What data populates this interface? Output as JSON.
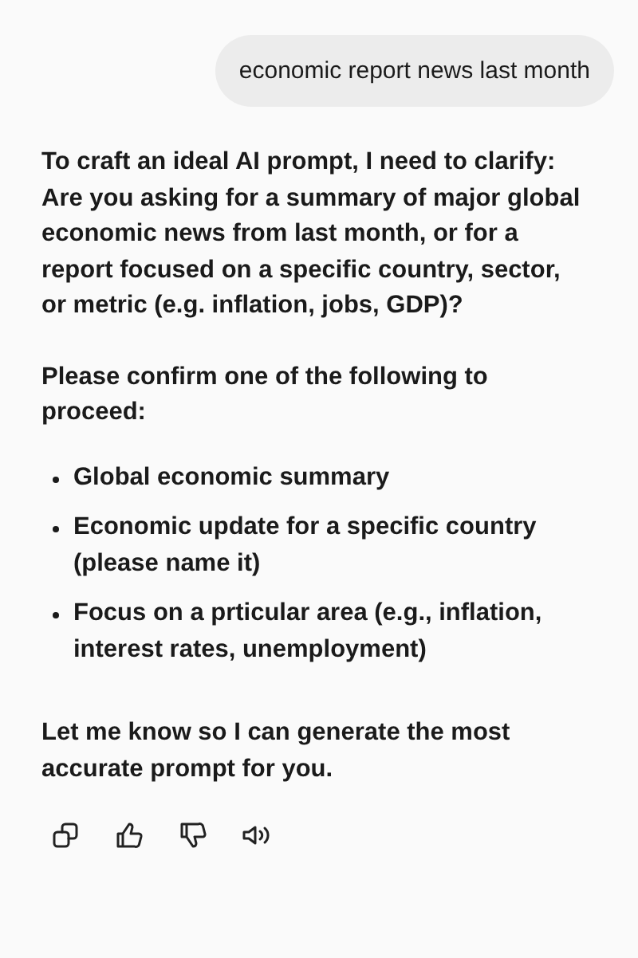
{
  "user_message": "economic report news last month",
  "reply": {
    "paragraphs": [
      "To craft an ideal AI prompt, I need to clarify: Are you asking for a summary of major global economic news from last month, or for a report focused on a specific country, sector, or metric (e.g. inflation, jobs, GDP)?",
      "Please confirm one of the following to proceed:"
    ],
    "options": [
      "Global economic summary",
      "Economic update for a specific country (please name it)",
      "Focus on a prticular area (e.g., inflation, interest rates, unemployment)"
    ],
    "closing": "Let me know so I can generate the most accurate prompt for you."
  },
  "actions": [
    {
      "kind": "copy"
    },
    {
      "kind": "like"
    },
    {
      "kind": "dislike"
    },
    {
      "kind": "speak"
    }
  ]
}
